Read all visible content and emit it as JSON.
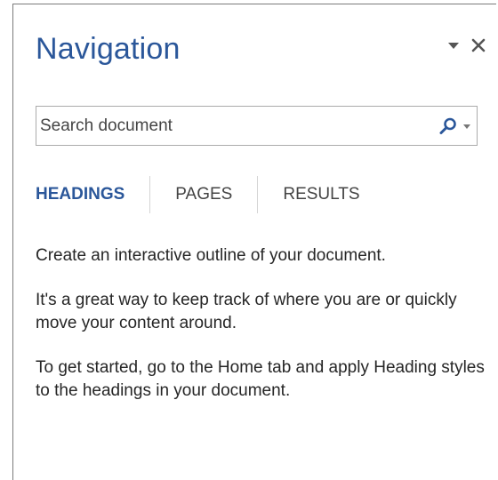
{
  "pane": {
    "title": "Navigation",
    "controls": {
      "options_icon": "triangle-down-icon",
      "close_glyph": "✕"
    }
  },
  "search": {
    "placeholder": "Search document",
    "value": "",
    "search_icon": "magnifier-icon",
    "options_arrow": "triangle-down-icon"
  },
  "tabs": [
    {
      "label": "HEADINGS",
      "active": true
    },
    {
      "label": "PAGES",
      "active": false
    },
    {
      "label": "RESULTS",
      "active": false
    }
  ],
  "message": {
    "line1": "Create an interactive outline of your document.",
    "line2": "It's a great way to keep track of where you are or quickly move your content around.",
    "line3": "To get started, go to the Home tab and apply Heading styles to the headings in your document."
  },
  "colors": {
    "accent": "#2b579a",
    "text": "#262626",
    "tab_inactive": "#444444",
    "border": "#ababab"
  }
}
